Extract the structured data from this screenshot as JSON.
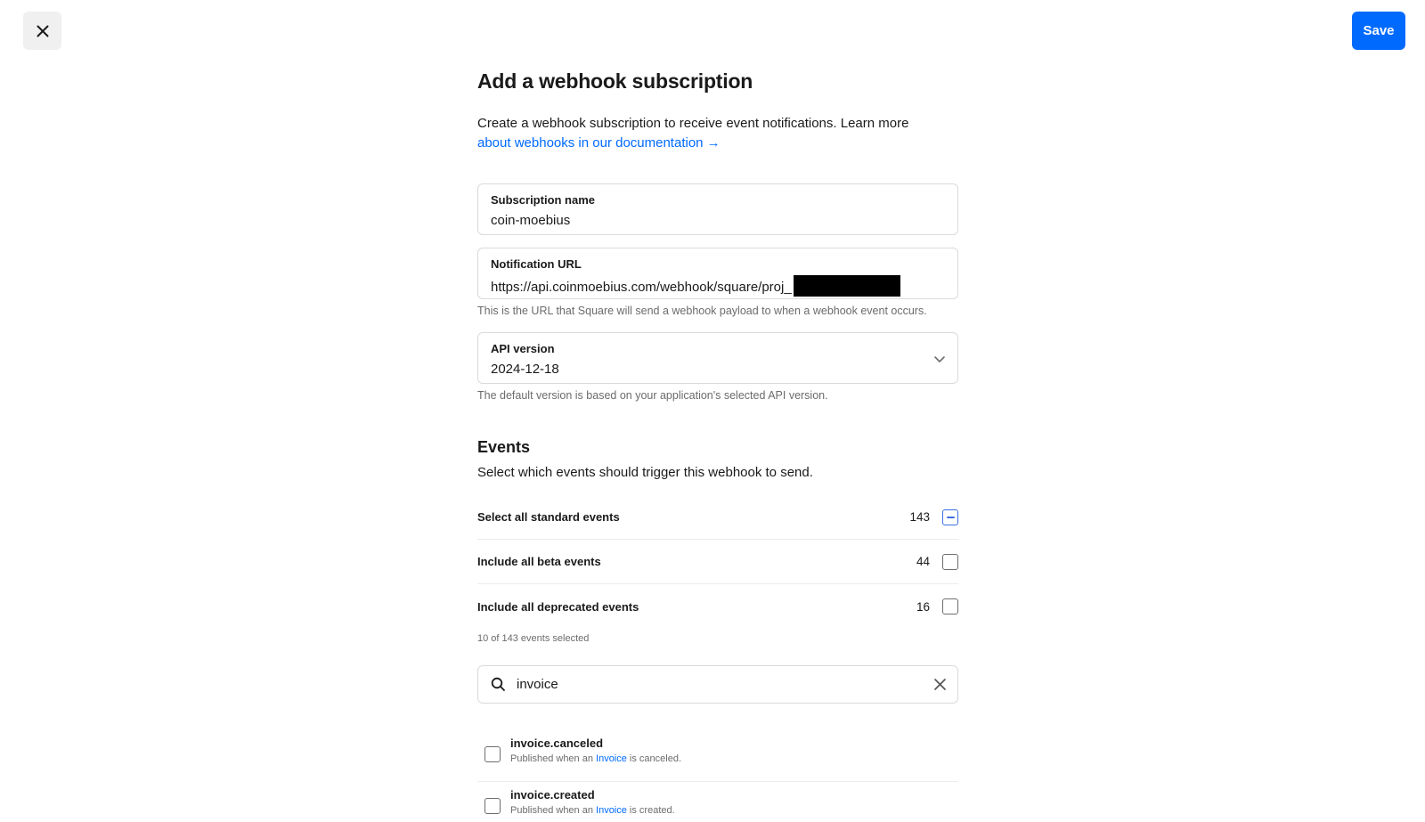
{
  "header": {
    "close_icon": "close-icon",
    "save_label": "Save",
    "accent_color": "#006aff"
  },
  "page": {
    "title": "Add a webhook subscription",
    "description_text": "Create a webhook subscription to receive event notifications. Learn more ",
    "description_link": "about webhooks in our documentation →"
  },
  "form": {
    "subscription_name": {
      "label": "Subscription name",
      "value": "coin-moebius"
    },
    "notification_url": {
      "label": "Notification URL",
      "value": "https://api.coinmoebius.com/webhook/square/proj_",
      "helper": "This is the URL that Square will send a webhook payload to when a webhook event occurs."
    },
    "api_version": {
      "label": "API version",
      "value": "2024-12-18",
      "helper": "The default version is based on your application's selected API version."
    }
  },
  "events": {
    "title": "Events",
    "subtitle": "Select which events should trigger this webhook to send.",
    "toggles": [
      {
        "label": "Select all standard events",
        "count": "143",
        "state": "indeterminate"
      },
      {
        "label": "Include all beta events",
        "count": "44",
        "state": "unchecked"
      },
      {
        "label": "Include all deprecated events",
        "count": "16",
        "state": "unchecked"
      }
    ],
    "selected_count": "10 of 143 events selected",
    "search": {
      "value": "invoice"
    },
    "list": [
      {
        "name": "invoice.canceled",
        "desc_prefix": "Published when an ",
        "desc_link": "Invoice",
        "desc_suffix": " is canceled."
      },
      {
        "name": "invoice.created",
        "desc_prefix": "Published when an ",
        "desc_link": "Invoice",
        "desc_suffix": " is created."
      }
    ]
  }
}
